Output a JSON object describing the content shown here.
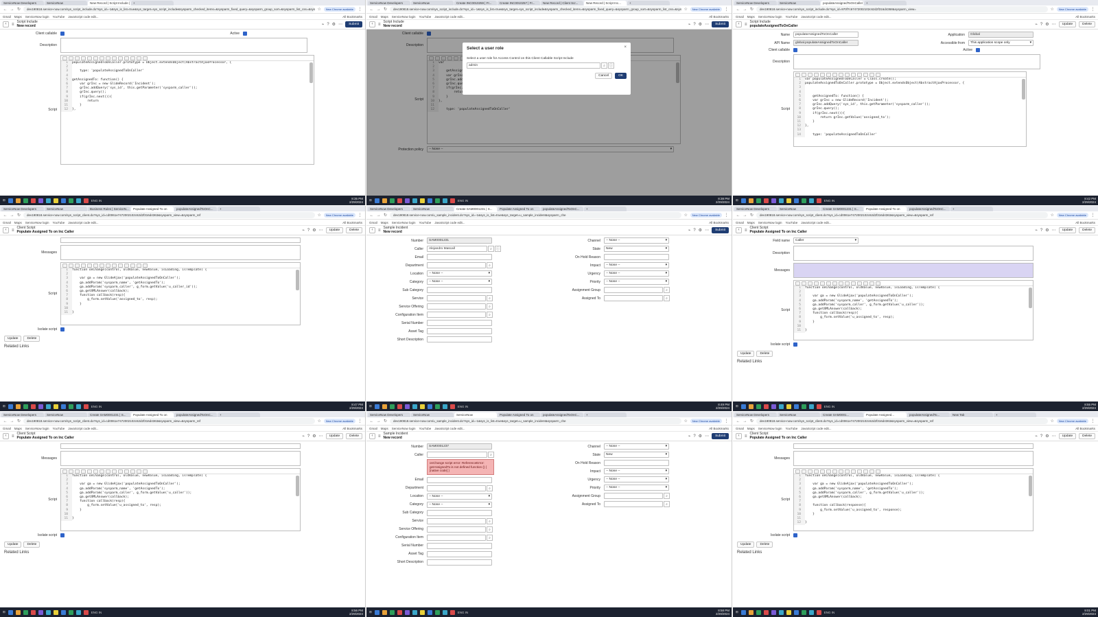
{
  "browser": {
    "url_include": "dev190818.service-now.com/sys_script_include.do?sys_id=-1&sys_is_list=true&sys_target=sys_script_include&sysparm_checked_items=&sysparm_fixed_query=&sysparm_group_sort=&sysparm_list_css=&sysparm_query=&sysparm_referring_url=",
    "url_include_saved": "dev190818.service-now.com/sys_script_include.do?sys_id=970f7c67472002102c62d2f316d4368&sysparm_view=",
    "url_client": "dev190818.service-now.com/sys_script_client.do?sys_id=cd0061e7472002102c62d2f316d4363&sysparm_view=&sysparm_ref",
    "url_incident": "dev190818.service-now.com/u_sample_incident.do?sys_id=-1&sys_is_list=true&sys_target=u_sample_incident&sysparm_che",
    "new_chrome": "New Chrome available",
    "bookmarks": [
      "Gmail",
      "Maps",
      "ServiceNow login",
      "YouTube",
      "JavaScript code edit..."
    ],
    "all_bookmarks": "All Bookmarks",
    "tabs_a": [
      "ServiceNow Developers",
      "ServiceNow",
      "New Record | Script Include |"
    ],
    "tabs_b": [
      "ServiceNow Developers",
      "ServiceNow",
      "Create INC0010259 | Fr...",
      "Create INC0010257 | Fr...",
      "New Record | Client Scr...",
      "New Record | Script Inc..."
    ],
    "tabs_c": [
      "ServiceNow Developers",
      "ServiceNow",
      "populateAssignedToOnCaller"
    ],
    "tabs_d": [
      "ServiceNow Developers",
      "ServiceNow",
      "Business Rules | ServiceN...",
      "Populate Assigned To on",
      "populateAssignedToOnC..."
    ],
    "tabs_e": [
      "ServiceNow Developers",
      "ServiceNow",
      "Create SAM0001231 | S...",
      "Populate Assigned To on",
      "populateAssignedToOnC..."
    ],
    "tabs_f": [
      "ServiceNow Developers",
      "ServiceNow",
      "Create SAM0001231 | S...",
      "Populate Assigned To on",
      "populateAssignedToOnC..."
    ],
    "tabs_g": [
      "ServiceNow Developers",
      "ServiceNow",
      "Create SAM0001231 | S...",
      "Populate Assigned To on",
      "populateAssignedToOnC..."
    ],
    "tabs_h": [
      "ServiceNow Developers",
      "ServiceNow",
      "ServiceNow",
      "Populate Assigned To on",
      "populateAssignedToOnC..."
    ],
    "tabs_i": [
      "ServiceNow Developers",
      "ServiceNow",
      "Create SAM0001...",
      "Populate Assigned...",
      "populateAssignedTo...",
      "New Tab"
    ]
  },
  "taskbar": {
    "sys": "ENG IN",
    "times": [
      "8:35 PM",
      "8:38 PM",
      "8:42 PM",
      "8:47 PM",
      "8:49 PM",
      "8:55 PM",
      "8:56 PM",
      "8:58 PM",
      "9:01 PM"
    ],
    "date": "2/29/2024"
  },
  "include_form": {
    "breadcrumb": "Script Include",
    "record": "New record",
    "record_saved": "populateAssignedToOnCaller",
    "submit": "Submit",
    "update": "Update",
    "delete": "Delete",
    "client_callable": "Client callable",
    "active": "Active",
    "description": "Description",
    "script": "Script",
    "name_label": "Name",
    "name_value": "populateAssignedToOnCaller",
    "api_label": "API Name",
    "api_value": "global.populateAssignedToOnCaller",
    "application_label": "Application",
    "application_value": "Global",
    "accessible_label": "Accessible from",
    "accessible_value": "This application scope only",
    "protection_label": "Protection policy",
    "protection_value": "-- None --"
  },
  "role_dialog": {
    "title": "Select a user role",
    "subtitle": "Select a user role for Access Control on this Client Callable Script Include",
    "value": "admin",
    "cancel": "Cancel",
    "ok": "OK"
  },
  "client_form": {
    "breadcrumb": "Client Script",
    "record": "Populate Assigned To on Inc Caller",
    "record_alt": "populateAssignedToOnCaller",
    "messages": "Messages",
    "script": "Script",
    "isolate": "Isolate script",
    "field_name": "Field name",
    "field_value": "Caller",
    "description": "Description",
    "related": "Related Links",
    "update": "Update",
    "delete": "Delete"
  },
  "incident_form": {
    "breadcrumb": "Sample Incident",
    "record": "New record",
    "submit": "Submit",
    "number_label": "Number",
    "number_value": "SAM0001231",
    "number_value_2": "SAM0001237",
    "caller_label": "Caller",
    "caller_value": "Alejandro Mascall",
    "left_labels": [
      "Email",
      "Department",
      "Location",
      "Category",
      "Sub Category",
      "Service",
      "Service Offering",
      "Configuration Item",
      "Serial Number",
      "Asset Tag",
      "Short Description"
    ],
    "right_labels": [
      "Channel",
      "State",
      "On Hold Reason",
      "Impact",
      "Urgency",
      "Priority",
      "Assignment Group",
      "Assigned To"
    ],
    "none_option": "-- None --",
    "state_value": "New",
    "error": "onChange script error: ReferenceError: getAssignedTo is not defined function () { [native code] }"
  },
  "code": {
    "include_draft": [
      "populateAssignedToOnCaller.prototype = Object.extendsObject(AbstractAjaxProcessor, {",
      "",
      "    type: 'populateAssignedToOnCaller'",
      "",
      "getAssignedTo: function() {",
      "    var grInc = new GlideRecord('Incident');",
      "    grInc.addQuery('sys_id', this.getParameter('sysparm_caller'));",
      "    grInc.query();",
      "    if(grInc.next()){",
      "        return",
      "    }",
      "},"
    ],
    "include_modal": [
      "var",
      "",
      "    getAssignedTo: function() {",
      "    var grInc = new GlideRecord('Incident');",
      "    grInc.addQuery('sys_id', this.getParameter('sysparm_caller'));",
      "    grInc.query();",
      "    if(grInc.next()){",
      "        return grInc.getValue('assigned_to');",
      "    }",
      "},",
      "",
      "    type: 'populateAssignedToOnCaller'"
    ],
    "include_saved": [
      "var populateAssignedToOnCaller = Class.create();",
      "populateAssignedToOnCaller.prototype = Object.extendsObject(AbstractAjaxProcessor, {",
      "",
      "",
      "    getAssignedTo: function() {",
      "    var grInc = new GlideRecord('Incident');",
      "    grInc.addQuery('sys_id', this.getParameter('sysparm_caller'));",
      "    grInc.query();",
      "    if(grInc.next()){",
      "        return grInc.getValue('assigned_to');",
      "    }",
      "},",
      "",
      "    type: 'populateAssignedToOnCaller'"
    ],
    "client_v1": [
      "function onChange(control, oldValue, newValue, isLoading, isTemplate) {",
      "",
      "    var ga = new GlideAjax('populateAssignedToOnCaller');",
      "    ga.addParam('sysparm_name', 'getAssignedTo');",
      "    ga.addParam('sysparm_caller', g_form.getValue('u_caller_id'));",
      "    ga.getXMLAnswer(callback);",
      "    function callback(resp){",
      "        g_form.setValue('assigned_to', resp);",
      "    }",
      "",
      "}"
    ],
    "client_v2": [
      "function onChange(control, oldValue, newValue, isLoading, isTemplate) {",
      "",
      "    var ga = new GlideAjax('populateAssignedToOnCaller');",
      "    ga.addParam('sysparm_name', 'getAssignedTo');",
      "    ga.addParam('sysparm_caller', g_form.getValue('u_caller'));",
      "    ga.getXMLAnswer(callback);",
      "    function callback(resp){",
      "        g_form.setValue('u_assigned_to', resp);",
      "    }",
      "",
      "}"
    ],
    "client_v3": [
      "function onChange(control, oldValue, newValue, isLoading, isTemplate) {",
      "",
      "    var ga = new GlideAjax('populateAssignedToOnCaller');",
      "    ga.addParam('sysparm_name', 'getAssignedTo');",
      "    ga.addParam('sysparm_caller', g_form.getValue('u_caller'));",
      "    ga.getXMLAnswer(callback);",
      "",
      "    function callback(response){",
      "        g_form.setValue('u_assigned_to', response);",
      "    }",
      "",
      "}"
    ]
  }
}
